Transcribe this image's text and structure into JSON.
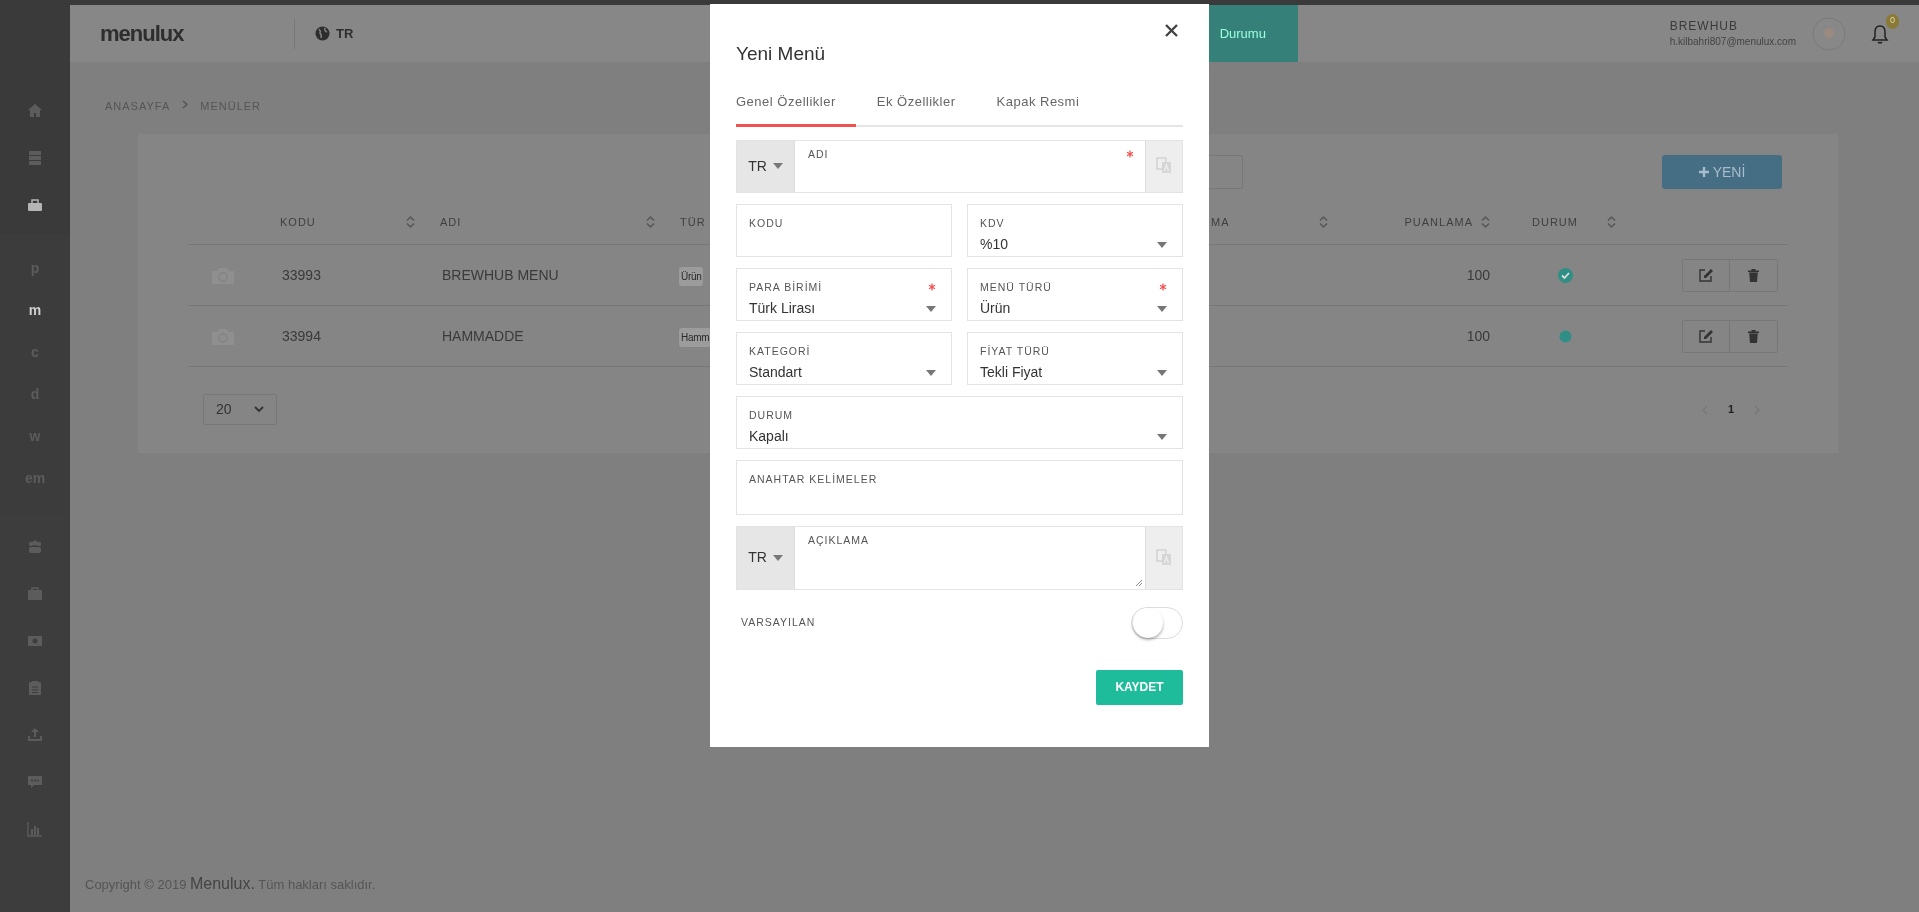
{
  "sidebar": {
    "top_items": [
      {
        "selected": false
      },
      {
        "selected": false
      },
      {
        "selected": true
      }
    ],
    "letter_items": [
      {
        "label": "p",
        "selected": false
      },
      {
        "label": "m",
        "selected": true
      },
      {
        "label": "c",
        "selected": false
      },
      {
        "label": "d",
        "selected": false
      },
      {
        "label": "w",
        "selected": false
      },
      {
        "label": "em",
        "selected": false
      }
    ],
    "bottom_items": [
      {
        "selected": false
      },
      {
        "selected": false
      },
      {
        "selected": false
      },
      {
        "selected": false
      },
      {
        "selected": false
      },
      {
        "selected": false
      },
      {
        "selected": false
      }
    ]
  },
  "header": {
    "logo": "menulux",
    "language": "TR",
    "status_button": "Durumu",
    "user_name": "BREWHUB",
    "user_email": "h.kilbahri807@menulux.com",
    "notification_count": "0"
  },
  "breadcrumb": [
    "ANASAYFA",
    "MENÜLER"
  ],
  "new_button": "YENİ",
  "table": {
    "columns": [
      {
        "label": "KODU",
        "sortable": true
      },
      {
        "label": "ADI",
        "sortable": true
      },
      {
        "label": "TÜR",
        "sortable": false
      },
      {
        "label": "MA",
        "sortable": true
      },
      {
        "label": "PUANLAMA",
        "sortable": true
      },
      {
        "label": "DURUM",
        "sortable": true
      }
    ],
    "rows": [
      {
        "code": "33993",
        "name": "BREWHUB MENU",
        "type": "Ürün",
        "rating": "100",
        "checked": true
      },
      {
        "code": "33994",
        "name": "HAMMADDE",
        "type": "Hamm",
        "rating": "100",
        "checked": false
      }
    ]
  },
  "page_size": "20",
  "pages": [
    {
      "label": "1",
      "selected": true
    }
  ],
  "footer": "Copyright © 2019 **Menulux.** Tüm hakları saklıdır.",
  "modal": {
    "title": "Yeni Menü",
    "tabs": [
      {
        "label": "Genel Özellikler",
        "selected": true
      },
      {
        "label": "Ek Özellikler",
        "selected": false
      },
      {
        "label": "Kapak Resmi",
        "selected": false
      }
    ],
    "field_rows": [
      [
        {
          "kind": "translatable",
          "language": "TR",
          "label": "ADI",
          "required": true
        }
      ],
      [
        {
          "kind": "text",
          "label": "KODU",
          "required": false
        },
        {
          "kind": "select",
          "label": "KDV",
          "value": "%10",
          "required": false
        }
      ],
      [
        {
          "kind": "select",
          "label": "PARA BİRİMİ",
          "value": "Türk Lirası",
          "required": true
        },
        {
          "kind": "select",
          "label": "MENÜ TÜRÜ",
          "value": "Ürün",
          "required": true
        }
      ],
      [
        {
          "kind": "select",
          "label": "KATEGORİ",
          "value": "Standart",
          "required": false
        },
        {
          "kind": "select",
          "label": "FİYAT TÜRÜ",
          "value": "Tekli Fiyat",
          "required": false
        }
      ],
      [
        {
          "kind": "select",
          "label": "DURUM",
          "value": "Kapalı",
          "required": false
        }
      ],
      [
        {
          "kind": "text",
          "label": "ANAHTAR KELİMELER",
          "required": false
        }
      ],
      [
        {
          "kind": "translatable_textarea",
          "language": "TR",
          "label": "AÇIKLAMA",
          "required": false
        }
      ]
    ],
    "toggle": {
      "label": "VARSAYILAN",
      "on": false
    },
    "save_button": "KAYDET"
  }
}
